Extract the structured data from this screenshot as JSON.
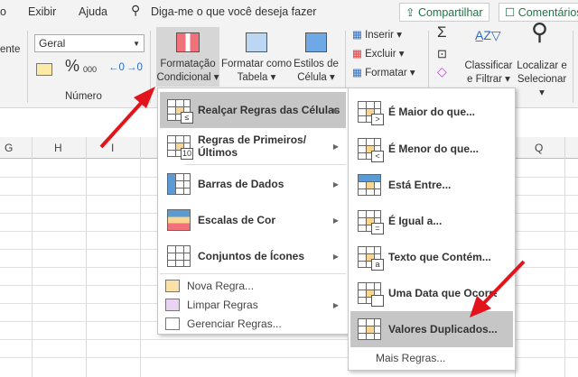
{
  "tabs": {
    "items": [
      "o",
      "Exibir",
      "Ajuda"
    ],
    "search": "Diga-me o que você deseja fazer",
    "share": "Compartilhar",
    "comments": "Comentários"
  },
  "ribbon": {
    "left_partial": "ente",
    "number_format": "Geral",
    "percent": "%",
    "thousands": "000",
    "number_group": "Número",
    "cond_format": [
      "Formatação",
      "Condicional ▾"
    ],
    "format_table": [
      "Formatar como",
      "Tabela ▾"
    ],
    "cell_styles": [
      "Estilos de",
      "Célula ▾"
    ],
    "insert": "Inserir ▾",
    "delete": "Excluir ▾",
    "format": "Formatar ▾",
    "sort_filter": [
      "Classificar",
      "e Filtrar ▾"
    ],
    "find_select": [
      "Localizar e",
      "Selecionar ▾"
    ]
  },
  "columns": [
    "G",
    "H",
    "I",
    "Q"
  ],
  "menu": {
    "items": [
      {
        "label": "Realçar Regras das Células",
        "badge": "≤"
      },
      {
        "label": "Regras de Primeiros/Últimos",
        "badge": "10"
      },
      {
        "label": "Barras de Dados"
      },
      {
        "label": "Escalas de Cor"
      },
      {
        "label": "Conjuntos de Ícones"
      }
    ],
    "small": [
      "Nova Regra...",
      "Limpar Regras",
      "Gerenciar Regras..."
    ]
  },
  "submenu": {
    "items": [
      {
        "label": "É Maior do que...",
        "badge": ">"
      },
      {
        "label": "É Menor do que...",
        "badge": "<"
      },
      {
        "label": "Está Entre..."
      },
      {
        "label": "É Igual a...",
        "badge": "="
      },
      {
        "label": "Texto que Contém...",
        "badge": "a"
      },
      {
        "label": "Uma Data que Ocorre...",
        "badge": ""
      },
      {
        "label": "Valores Duplicados..."
      }
    ],
    "more": "Mais Regras..."
  },
  "colors": {
    "accent": "#217346",
    "arrow": "#e3131b",
    "highlight": "#c6c6c6"
  }
}
